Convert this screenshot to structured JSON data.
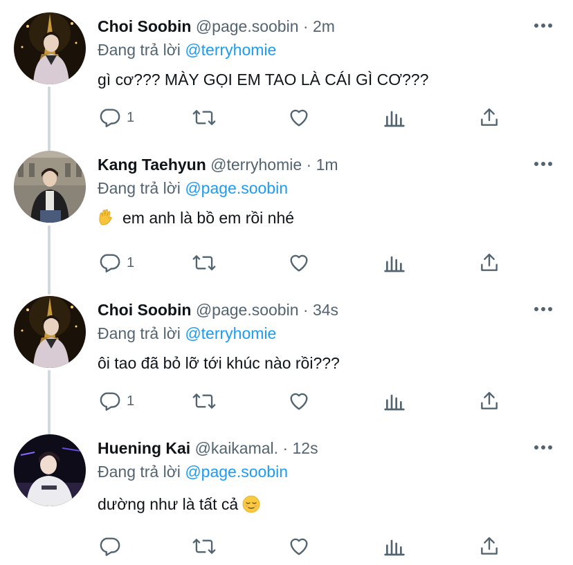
{
  "reply_prefix": "Đang trả lời",
  "tweets": [
    {
      "name": "Choi Soobin",
      "handle": "@page.soobin",
      "time": "2m",
      "reply_to": "@terryhomie",
      "text": "gì cơ??? MÀY GỌI EM TAO LÀ CÁI GÌ CƠ???",
      "reply_count": "1",
      "avatar": "avatar-eiffel-night"
    },
    {
      "name": "Kang Taehyun",
      "handle": "@terryhomie",
      "time": "1m",
      "reply_to": "@page.soobin",
      "text": "em anh là bồ em rồi nhé",
      "emoji_before": "waving-hand-emoji",
      "reply_count": "1",
      "avatar": "avatar-louvre"
    },
    {
      "name": "Choi Soobin",
      "handle": "@page.soobin",
      "time": "34s",
      "reply_to": "@terryhomie",
      "text": "ôi tao đã bỏ lỡ tới khúc nào rồi???",
      "reply_count": "1",
      "avatar": "avatar-eiffel-night"
    },
    {
      "name": "Huening Kai",
      "handle": "@kaikamal.",
      "time": "12s",
      "reply_to": "@page.soobin",
      "text": "dường như là tất cả",
      "emoji_after": "relieved-face-emoji",
      "reply_count": "",
      "avatar": "avatar-dark-studio"
    }
  ],
  "colors": {
    "text_primary": "#0f1419",
    "text_secondary": "#536471",
    "mention": "#1d9bf0",
    "thread_line": "#cfd9de"
  }
}
